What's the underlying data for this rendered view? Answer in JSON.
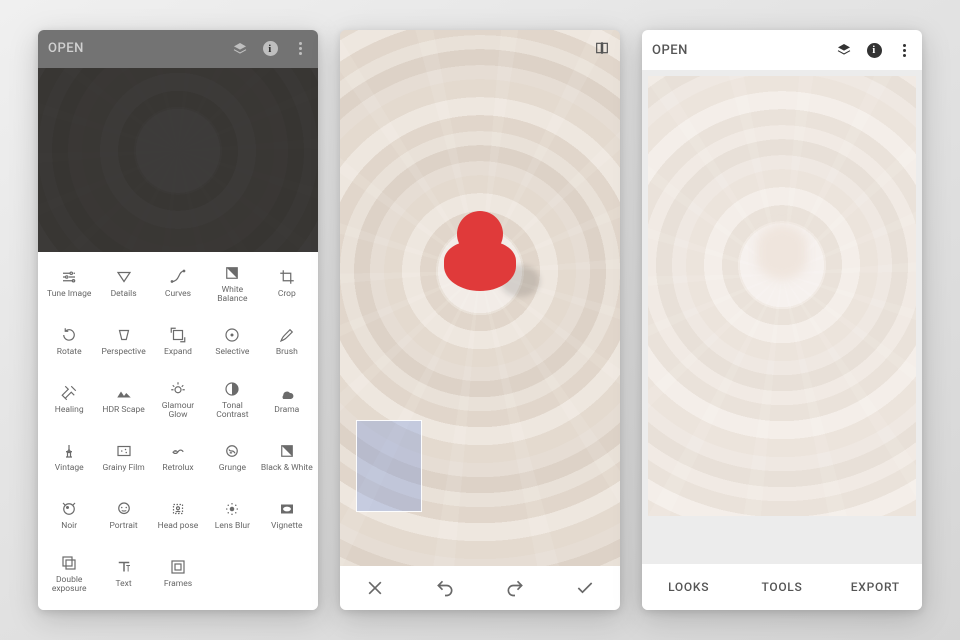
{
  "screen1": {
    "open_label": "OPEN",
    "tools": [
      {
        "label": "Tune Image"
      },
      {
        "label": "Details"
      },
      {
        "label": "Curves"
      },
      {
        "label": "White Balance"
      },
      {
        "label": "Crop"
      },
      {
        "label": "Rotate"
      },
      {
        "label": "Perspective"
      },
      {
        "label": "Expand"
      },
      {
        "label": "Selective"
      },
      {
        "label": "Brush"
      },
      {
        "label": "Healing"
      },
      {
        "label": "HDR Scape"
      },
      {
        "label": "Glamour Glow"
      },
      {
        "label": "Tonal Contrast"
      },
      {
        "label": "Drama"
      },
      {
        "label": "Vintage"
      },
      {
        "label": "Grainy Film"
      },
      {
        "label": "Retrolux"
      },
      {
        "label": "Grunge"
      },
      {
        "label": "Black & White"
      },
      {
        "label": "Noir"
      },
      {
        "label": "Portrait"
      },
      {
        "label": "Head pose"
      },
      {
        "label": "Lens Blur"
      },
      {
        "label": "Vignette"
      },
      {
        "label": "Double exposure"
      },
      {
        "label": "Text"
      },
      {
        "label": "Frames"
      }
    ]
  },
  "screen3": {
    "open_label": "OPEN",
    "bottom": {
      "looks": "LOOKS",
      "tools": "TOOLS",
      "export": "EXPORT"
    }
  }
}
